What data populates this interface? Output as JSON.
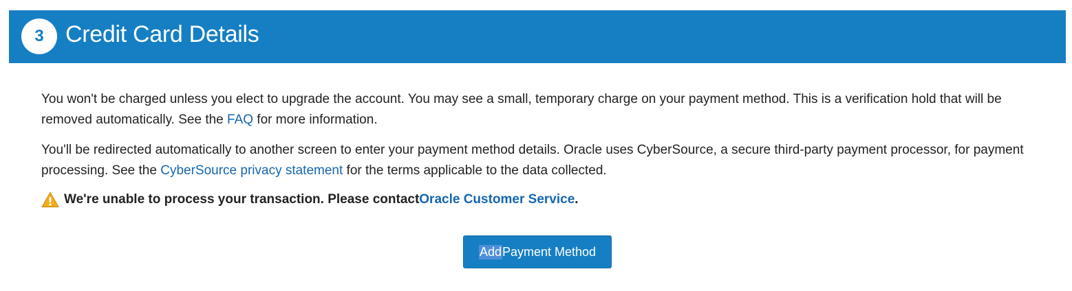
{
  "header": {
    "step_number": "3",
    "title": "Credit Card Details"
  },
  "paragraph1": {
    "text_before": "You won't be charged unless you elect to upgrade the account. You may see a small, temporary charge on your payment method. This is a verification hold that will be removed automatically. See the ",
    "link": "FAQ",
    "text_after": " for more information."
  },
  "paragraph2": {
    "text_before": "You'll be redirected automatically to another screen to enter your payment method details. Oracle uses CyberSource, a secure third-party payment processor, for payment processing. See the ",
    "link": "CyberSource privacy statement",
    "text_after": " for the terms applicable to the data collected."
  },
  "warning": {
    "icon": "warning-icon",
    "text": "We're unable to process your transaction. Please contact ",
    "link": "Oracle Customer Service",
    "suffix": "."
  },
  "button": {
    "label_selected": "Add",
    "label_rest": " Payment Method"
  },
  "colors": {
    "header_bg": "#167fc4",
    "link": "#1566b0",
    "button_bg": "#167fc4",
    "warning_icon": "#f0ad1e"
  }
}
